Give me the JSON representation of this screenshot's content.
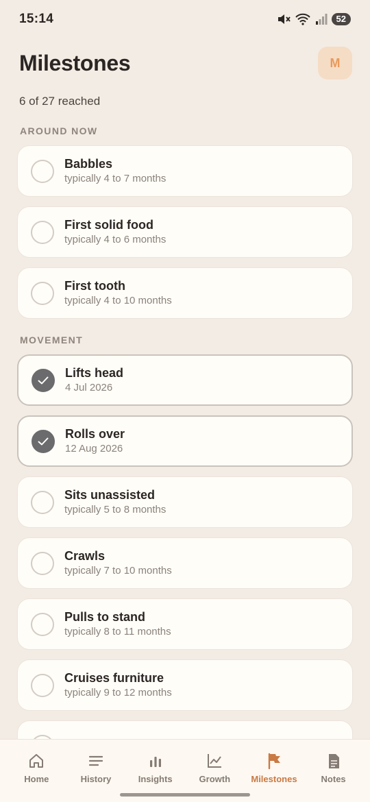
{
  "status": {
    "time": "15:14",
    "battery": "52"
  },
  "header": {
    "title": "Milestones",
    "avatar_initial": "M"
  },
  "progress": "6 of 27 reached",
  "sections": [
    {
      "title": "AROUND NOW",
      "items": [
        {
          "title": "Babbles",
          "subtitle": "typically 4 to 7 months",
          "done": false
        },
        {
          "title": "First solid food",
          "subtitle": "typically 4 to 6 months",
          "done": false
        },
        {
          "title": "First tooth",
          "subtitle": "typically 4 to 10 months",
          "done": false
        }
      ]
    },
    {
      "title": "MOVEMENT",
      "items": [
        {
          "title": "Lifts head",
          "subtitle": "4 Jul 2026",
          "done": true
        },
        {
          "title": "Rolls over",
          "subtitle": "12 Aug 2026",
          "done": true
        },
        {
          "title": "Sits unassisted",
          "subtitle": "typically 5 to 8 months",
          "done": false
        },
        {
          "title": "Crawls",
          "subtitle": "typically 7 to 10 months",
          "done": false
        },
        {
          "title": "Pulls to stand",
          "subtitle": "typically 8 to 11 months",
          "done": false
        },
        {
          "title": "Cruises furniture",
          "subtitle": "typically 9 to 12 months",
          "done": false
        }
      ]
    }
  ],
  "nav": [
    {
      "label": "Home",
      "icon": "home-icon",
      "active": false
    },
    {
      "label": "History",
      "icon": "history-icon",
      "active": false
    },
    {
      "label": "Insights",
      "icon": "insights-icon",
      "active": false
    },
    {
      "label": "Growth",
      "icon": "growth-icon",
      "active": false
    },
    {
      "label": "Milestones",
      "icon": "flag-icon",
      "active": true
    },
    {
      "label": "Notes",
      "icon": "notes-icon",
      "active": false
    }
  ],
  "colors": {
    "accent": "#c97a45",
    "background": "#f3ece4",
    "card": "#fffdf8",
    "check_filled": "#6b6a6c"
  }
}
